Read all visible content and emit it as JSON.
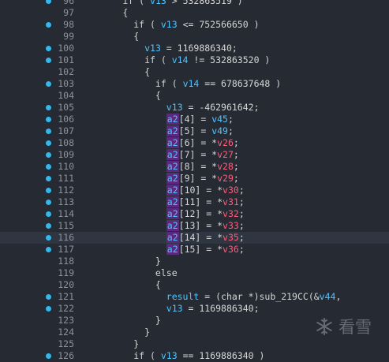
{
  "editor": {
    "lines": [
      {
        "n": "96",
        "bp": true,
        "segments": [
          {
            "t": "        if ( ",
            "c": ""
          },
          {
            "t": "v13",
            "c": "var"
          },
          {
            "t": " > 532863519 )",
            "c": ""
          }
        ]
      },
      {
        "n": "97",
        "bp": false,
        "segments": [
          {
            "t": "        {",
            "c": ""
          }
        ]
      },
      {
        "n": "98",
        "bp": true,
        "segments": [
          {
            "t": "          if ( ",
            "c": ""
          },
          {
            "t": "v13",
            "c": "var"
          },
          {
            "t": " <= 752566650 )",
            "c": ""
          }
        ]
      },
      {
        "n": "99",
        "bp": false,
        "segments": [
          {
            "t": "          {",
            "c": ""
          }
        ]
      },
      {
        "n": "100",
        "bp": true,
        "segments": [
          {
            "t": "            ",
            "c": ""
          },
          {
            "t": "v13",
            "c": "var"
          },
          {
            "t": " = 1169886340;",
            "c": ""
          }
        ]
      },
      {
        "n": "101",
        "bp": true,
        "segments": [
          {
            "t": "            if ( ",
            "c": ""
          },
          {
            "t": "v14",
            "c": "var"
          },
          {
            "t": " != 532863520 )",
            "c": ""
          }
        ]
      },
      {
        "n": "102",
        "bp": false,
        "segments": [
          {
            "t": "            {",
            "c": ""
          }
        ]
      },
      {
        "n": "103",
        "bp": true,
        "segments": [
          {
            "t": "              if ( ",
            "c": ""
          },
          {
            "t": "v14",
            "c": "var"
          },
          {
            "t": " == 678637648 )",
            "c": ""
          }
        ]
      },
      {
        "n": "104",
        "bp": false,
        "segments": [
          {
            "t": "              {",
            "c": ""
          }
        ]
      },
      {
        "n": "105",
        "bp": true,
        "segments": [
          {
            "t": "                ",
            "c": ""
          },
          {
            "t": "v13",
            "c": "var"
          },
          {
            "t": " = -462961642;",
            "c": ""
          }
        ]
      },
      {
        "n": "106",
        "bp": true,
        "segments": [
          {
            "t": "                ",
            "c": ""
          },
          {
            "t": "a2",
            "c": "hl-var"
          },
          {
            "t": "[4] = ",
            "c": ""
          },
          {
            "t": "v45",
            "c": "var"
          },
          {
            "t": ";",
            "c": ""
          }
        ]
      },
      {
        "n": "107",
        "bp": true,
        "segments": [
          {
            "t": "                ",
            "c": ""
          },
          {
            "t": "a2",
            "c": "hl-var"
          },
          {
            "t": "[5] = ",
            "c": ""
          },
          {
            "t": "v49",
            "c": "var"
          },
          {
            "t": ";",
            "c": ""
          }
        ]
      },
      {
        "n": "108",
        "bp": true,
        "segments": [
          {
            "t": "                ",
            "c": ""
          },
          {
            "t": "a2",
            "c": "hl-var"
          },
          {
            "t": "[6] = *",
            "c": ""
          },
          {
            "t": "v26",
            "c": "ptr"
          },
          {
            "t": ";",
            "c": ""
          }
        ]
      },
      {
        "n": "109",
        "bp": true,
        "segments": [
          {
            "t": "                ",
            "c": ""
          },
          {
            "t": "a2",
            "c": "hl-var"
          },
          {
            "t": "[7] = *",
            "c": ""
          },
          {
            "t": "v27",
            "c": "ptr"
          },
          {
            "t": ";",
            "c": ""
          }
        ]
      },
      {
        "n": "110",
        "bp": true,
        "segments": [
          {
            "t": "                ",
            "c": ""
          },
          {
            "t": "a2",
            "c": "hl-var"
          },
          {
            "t": "[8] = *",
            "c": ""
          },
          {
            "t": "v28",
            "c": "ptr"
          },
          {
            "t": ";",
            "c": ""
          }
        ]
      },
      {
        "n": "111",
        "bp": true,
        "segments": [
          {
            "t": "                ",
            "c": ""
          },
          {
            "t": "a2",
            "c": "hl-var"
          },
          {
            "t": "[9] = *",
            "c": ""
          },
          {
            "t": "v29",
            "c": "ptr"
          },
          {
            "t": ";",
            "c": ""
          }
        ]
      },
      {
        "n": "112",
        "bp": true,
        "segments": [
          {
            "t": "                ",
            "c": ""
          },
          {
            "t": "a2",
            "c": "hl-var"
          },
          {
            "t": "[10] = *",
            "c": ""
          },
          {
            "t": "v30",
            "c": "ptr"
          },
          {
            "t": ";",
            "c": ""
          }
        ]
      },
      {
        "n": "113",
        "bp": true,
        "segments": [
          {
            "t": "                ",
            "c": ""
          },
          {
            "t": "a2",
            "c": "hl-var"
          },
          {
            "t": "[11] = *",
            "c": ""
          },
          {
            "t": "v31",
            "c": "ptr"
          },
          {
            "t": ";",
            "c": ""
          }
        ]
      },
      {
        "n": "114",
        "bp": true,
        "segments": [
          {
            "t": "                ",
            "c": ""
          },
          {
            "t": "a2",
            "c": "hl-var"
          },
          {
            "t": "[12] = *",
            "c": ""
          },
          {
            "t": "v32",
            "c": "ptr"
          },
          {
            "t": ";",
            "c": ""
          }
        ]
      },
      {
        "n": "115",
        "bp": true,
        "segments": [
          {
            "t": "                ",
            "c": ""
          },
          {
            "t": "a2",
            "c": "hl-var"
          },
          {
            "t": "[13] = *",
            "c": ""
          },
          {
            "t": "v33",
            "c": "ptr"
          },
          {
            "t": ";",
            "c": ""
          }
        ]
      },
      {
        "n": "116",
        "bp": true,
        "highlight": true,
        "segments": [
          {
            "t": "                ",
            "c": ""
          },
          {
            "t": "a2",
            "c": "hl-var"
          },
          {
            "t": "[14] = *",
            "c": ""
          },
          {
            "t": "v35",
            "c": "ptr"
          },
          {
            "t": ";",
            "c": ""
          }
        ]
      },
      {
        "n": "117",
        "bp": true,
        "segments": [
          {
            "t": "                ",
            "c": ""
          },
          {
            "t": "a2",
            "c": "hl-var"
          },
          {
            "t": "[15] = *",
            "c": ""
          },
          {
            "t": "v36",
            "c": "ptr"
          },
          {
            "t": ";",
            "c": ""
          }
        ]
      },
      {
        "n": "118",
        "bp": false,
        "segments": [
          {
            "t": "              }",
            "c": ""
          }
        ]
      },
      {
        "n": "119",
        "bp": false,
        "segments": [
          {
            "t": "              else",
            "c": ""
          }
        ]
      },
      {
        "n": "120",
        "bp": false,
        "segments": [
          {
            "t": "              {",
            "c": ""
          }
        ]
      },
      {
        "n": "121",
        "bp": true,
        "segments": [
          {
            "t": "                ",
            "c": ""
          },
          {
            "t": "result",
            "c": "var"
          },
          {
            "t": " = (",
            "c": ""
          },
          {
            "t": "char",
            "c": "kw"
          },
          {
            "t": " *)sub_219CC(&",
            "c": ""
          },
          {
            "t": "v44",
            "c": "var"
          },
          {
            "t": ",",
            "c": ""
          }
        ]
      },
      {
        "n": "122",
        "bp": true,
        "segments": [
          {
            "t": "                ",
            "c": ""
          },
          {
            "t": "v13",
            "c": "var"
          },
          {
            "t": " = 1169886340;",
            "c": ""
          }
        ]
      },
      {
        "n": "123",
        "bp": false,
        "segments": [
          {
            "t": "              }",
            "c": ""
          }
        ]
      },
      {
        "n": "124",
        "bp": false,
        "segments": [
          {
            "t": "            }",
            "c": ""
          }
        ]
      },
      {
        "n": "125",
        "bp": false,
        "segments": [
          {
            "t": "          }",
            "c": ""
          }
        ]
      },
      {
        "n": "126",
        "bp": true,
        "segments": [
          {
            "t": "          if ( ",
            "c": ""
          },
          {
            "t": "v13",
            "c": "var"
          },
          {
            "t": " == 1169886340 )",
            "c": ""
          }
        ]
      }
    ]
  },
  "watermark": {
    "text": "看雪"
  }
}
